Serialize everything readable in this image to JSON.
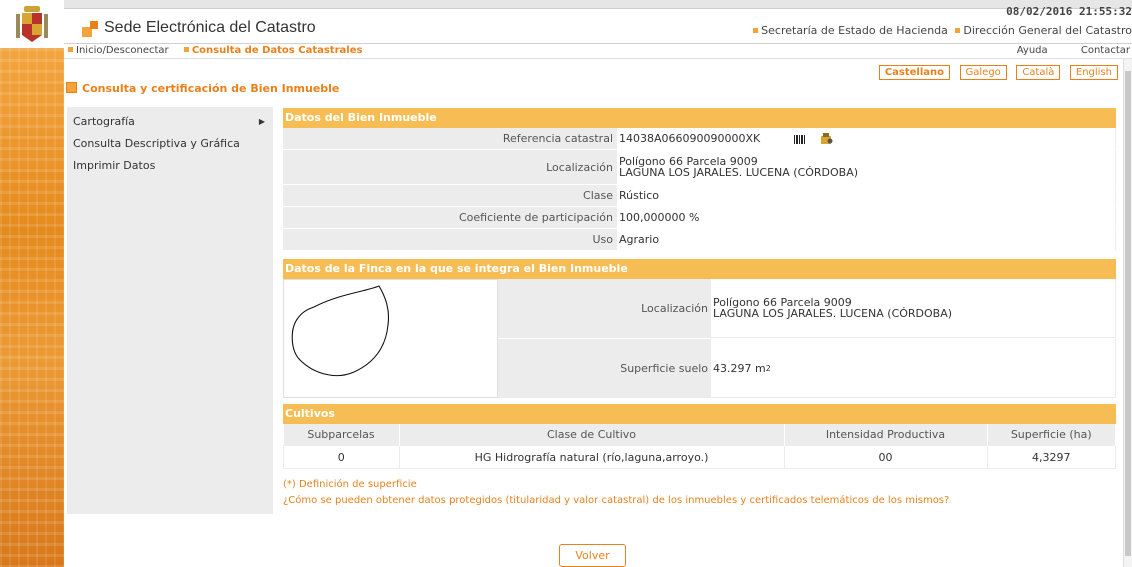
{
  "header": {
    "datetime": "08/02/2016 21:55:32",
    "site_title": "Sede Electrónica del Catastro",
    "link1": "Secretaría de Estado de Hacienda",
    "link2": "Dirección General del Catastro"
  },
  "nav": {
    "home": "Inicio/Desconectar",
    "current": "Consulta de Datos Catastrales",
    "help": "Ayuda",
    "contact": "Contactar"
  },
  "languages": [
    "Castellano",
    "Galego",
    "Català",
    "English"
  ],
  "page_title": "Consulta y certificación de Bien Inmueble",
  "sidebar": {
    "items": [
      {
        "label": "Cartografía"
      },
      {
        "label": "Consulta Descriptiva y Gráfica"
      },
      {
        "label": "Imprimir Datos"
      }
    ]
  },
  "inmueble": {
    "title": "Datos del Bien Inmueble",
    "ref_label": "Referencia catastral",
    "ref_value": "14038A066090090000XK",
    "loc_label": "Localización",
    "loc_line1": "Polígono 66 Parcela 9009",
    "loc_line2": "LAGUNA LOS JARALES. LUCENA (CÓRDOBA)",
    "clase_label": "Clase",
    "clase_value": "Rústico",
    "coef_label": "Coeficiente de participación",
    "coef_value": "100,000000 %",
    "uso_label": "Uso",
    "uso_value": "Agrario"
  },
  "finca": {
    "title": "Datos de la Finca en la que se integra el Bien Inmueble",
    "loc_label": "Localización",
    "loc_line1": "Polígono 66 Parcela 9009",
    "loc_line2": "LAGUNA LOS JARALES. LUCENA (CÓRDOBA)",
    "sup_label": "Superficie suelo",
    "sup_value": "43.297 m",
    "sup_unit_exp": "2"
  },
  "cultivos": {
    "title": "Cultivos",
    "headers": [
      "Subparcelas",
      "Clase de Cultivo",
      "Intensidad Productiva",
      "Superficie (ha)"
    ],
    "rows": [
      [
        "0",
        "HG Hidrografía natural (río,laguna,arroyo.)",
        "00",
        "4,3297"
      ]
    ]
  },
  "notes": {
    "def": "(*) Definición de superficie",
    "question": "¿Cómo se pueden obtener datos protegidos (titularidad y valor catastral) de los inmuebles y certificados telemáticos de los mismos?"
  },
  "volver": "Volver",
  "colors": {
    "accent": "#e9811b",
    "section": "#f7bd55",
    "gray": "#ececec"
  }
}
